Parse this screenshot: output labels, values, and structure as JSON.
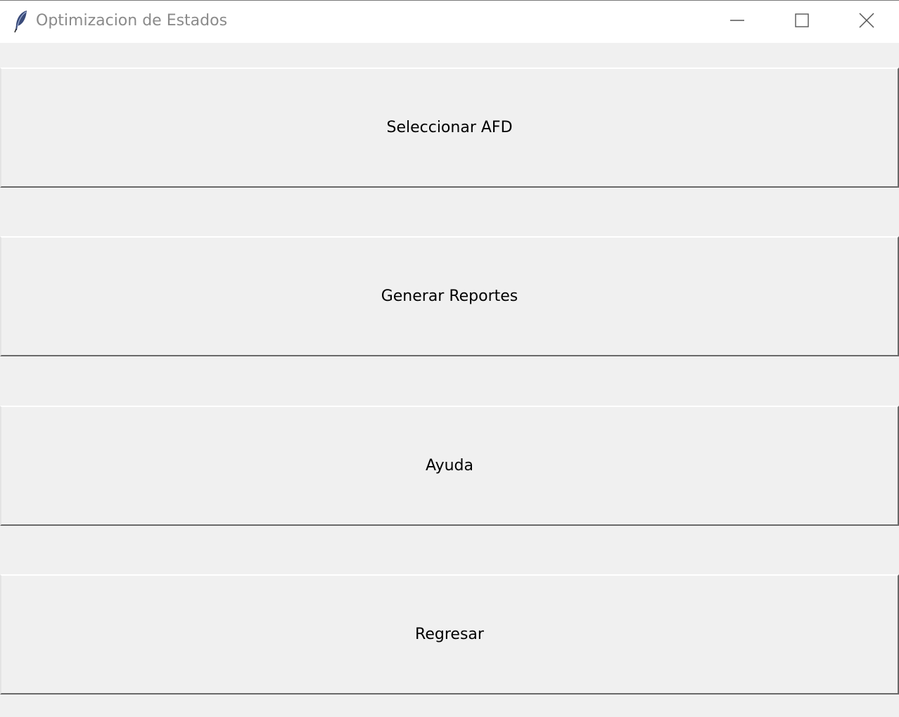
{
  "window": {
    "title": "Optimizacion de Estados",
    "icon": "feather-icon",
    "controls": {
      "minimize_icon": "minimize-icon",
      "maximize_icon": "maximize-icon",
      "close_icon": "close-icon"
    }
  },
  "menu": {
    "buttons": [
      {
        "label": "Seleccionar AFD"
      },
      {
        "label": "Generar Reportes"
      },
      {
        "label": "Ayuda"
      },
      {
        "label": "Regresar"
      }
    ]
  },
  "colors": {
    "background": "#f0f0f0",
    "titlebar": "#ffffff",
    "title_text": "#8a8a8a",
    "button_text": "#000000"
  }
}
